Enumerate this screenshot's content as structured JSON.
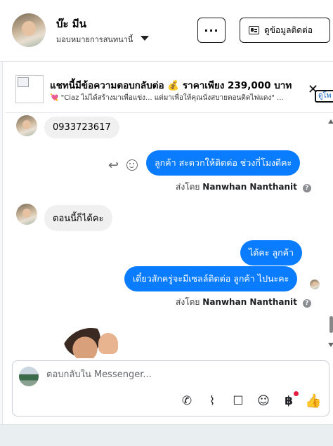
{
  "header": {
    "name": "บ๊ะ มีน",
    "assign_label": "มอบหมายการสนทนานี้",
    "more_label": "···",
    "info_button_label": "ดูข้อมูลติดต่อ"
  },
  "banner": {
    "title": "แชทนี้มีข้อความตอบกลับต่อ 💰 ราคาเพียง 239,000 บาท",
    "subtitle": "💘 \"Ciaz ไม่ได้สร้างมาเพื่อแข่ง... แต่มาเพื่อให้คุณนั่งสบายตอนติดไฟแดง\" ...",
    "view_label": "ดูโพ"
  },
  "messages": {
    "m1": "0933723617",
    "m2": "ลูกค้า สะดวกให้ติดต่อ ช่วงกี่โมงดีคะ",
    "sent_by_prefix": "ส่งโดย",
    "sent_by_name": "Nanwhan Nanthanit",
    "m3": "ตอนนี้ก็ได้คะ",
    "m4": "ได้คะ  ลูกค้า",
    "m5": "เดี๋ยวสักครู่จะมีเซลล์ติดต่อ ลูกค้า  ไปนะคะ"
  },
  "composer": {
    "placeholder": "ตอบกลับใน Messenger...",
    "baht_symbol": "฿"
  },
  "icons": {
    "reply": "reply-icon",
    "react": "emoji-icon",
    "call": "phone-icon",
    "attach": "paperclip-icon",
    "chat": "chat-icon",
    "emoji": "emoji-icon",
    "like": "thumbs-up-icon"
  },
  "colors": {
    "outgoing_bubble": "#0a7cff",
    "incoming_bubble": "#f0f0f0",
    "like": "#1877f2"
  }
}
